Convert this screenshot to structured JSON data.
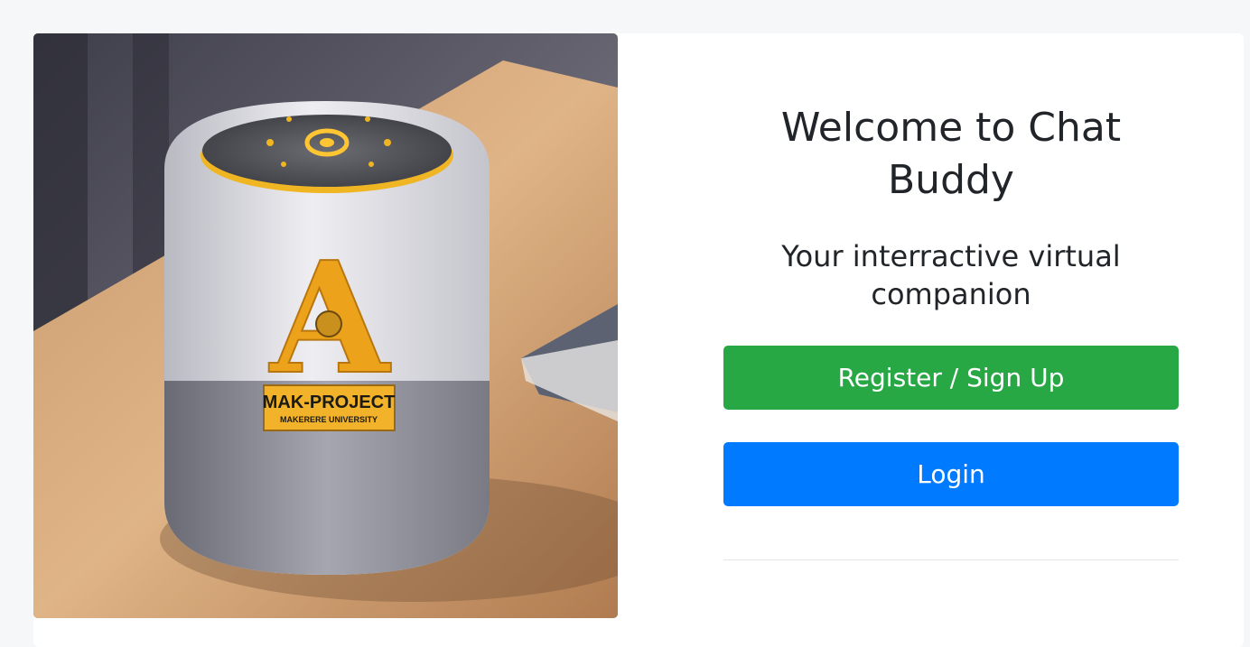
{
  "hero": {
    "alt": "Smart speaker with MAK-PROJECT label",
    "badge_letter": "A",
    "label_line1": "MAK-PROJECT",
    "label_line2": "MAKERERE UNIVERSITY"
  },
  "welcome": {
    "title": "Welcome to Chat Buddy",
    "subtitle": "Your interractive virtual companion"
  },
  "actions": {
    "register_label": "Register / Sign Up",
    "login_label": "Login"
  },
  "colors": {
    "register": "#28a745",
    "login": "#007bff",
    "page_bg": "#f6f7f9"
  }
}
